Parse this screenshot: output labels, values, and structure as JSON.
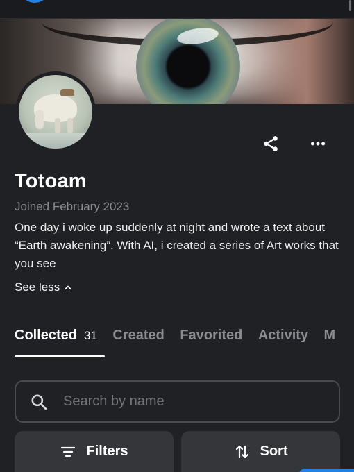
{
  "profile": {
    "name": "Totoam",
    "joined": "Joined February 2023",
    "bio": "One day i woke up suddenly at night and wrote a text about “Earth awakening”. With AI, i created a series of Art works that you see",
    "see_less": "See less"
  },
  "tabs": [
    {
      "label": "Collected",
      "count": "31",
      "active": true
    },
    {
      "label": "Created"
    },
    {
      "label": "Favorited"
    },
    {
      "label": "Activity"
    },
    {
      "label": "M"
    }
  ],
  "search": {
    "placeholder": "Search by name"
  },
  "buttons": {
    "filters": "Filters",
    "sort": "Sort"
  },
  "icons": {
    "share": "share-icon",
    "more": "more-horizontal-icon",
    "see_less": "chevron-up-icon",
    "search": "search-icon",
    "filters": "filter-lines-icon",
    "sort": "sort-arrows-icon"
  },
  "colors": {
    "background": "#202124",
    "accent": "#2081e2",
    "muted_text": "#8a8c91",
    "button_bg": "#35363a"
  }
}
